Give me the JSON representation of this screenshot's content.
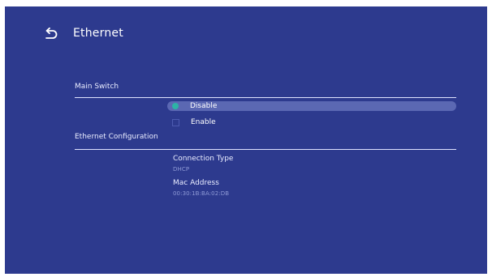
{
  "header": {
    "title": "Ethernet",
    "back_icon": "back-arrow-icon"
  },
  "main_switch": {
    "label": "Main Switch",
    "options": [
      {
        "label": "Disable",
        "selected": true
      },
      {
        "label": "Enable",
        "selected": false
      }
    ]
  },
  "ethernet_configuration": {
    "label": "Ethernet Configuration",
    "connection_type_label": "Connection Type",
    "connection_type_value": "DHCP",
    "mac_address_label": "Mac Address",
    "mac_address_value": "00:30:1B:BA:02:DB"
  },
  "colors": {
    "background": "#2d3a8e",
    "highlight": "#5b68b3",
    "accent": "#2db3a6"
  }
}
